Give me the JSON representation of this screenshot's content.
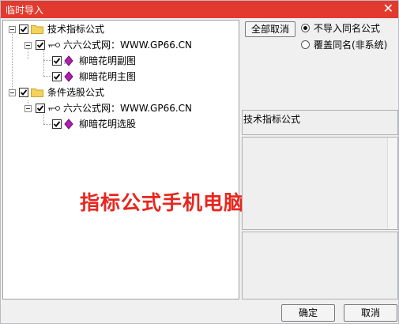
{
  "window": {
    "title": "临时导入",
    "close_glyph": "✕"
  },
  "tree": {
    "groups": [
      {
        "label": "技术指标公式",
        "source": {
          "label": "六六公式网：WWW.GP66.CN",
          "items": [
            {
              "label": "柳暗花明副图"
            },
            {
              "label": "柳暗花明主图"
            }
          ]
        }
      },
      {
        "label": "条件选股公式",
        "source": {
          "label": "六六公式网：WWW.GP66.CN",
          "items": [
            {
              "label": "柳暗花明选股"
            }
          ]
        }
      }
    ]
  },
  "overlay_text": "指标公式手机电脑通用",
  "right": {
    "clear_all_button": "全部取消",
    "radio_options": [
      {
        "label": "不导入同名公式",
        "selected": true
      },
      {
        "label": "覆盖同名(非系统)",
        "selected": false
      }
    ],
    "info_label": "技术指标公式"
  },
  "footer": {
    "ok_button": "确定",
    "cancel_button": "取消"
  },
  "colors": {
    "titlebar": "#e23a2e",
    "overlay_text": "#e8261e",
    "diamond": "#b01fb0",
    "folder": "#f3d35b"
  }
}
